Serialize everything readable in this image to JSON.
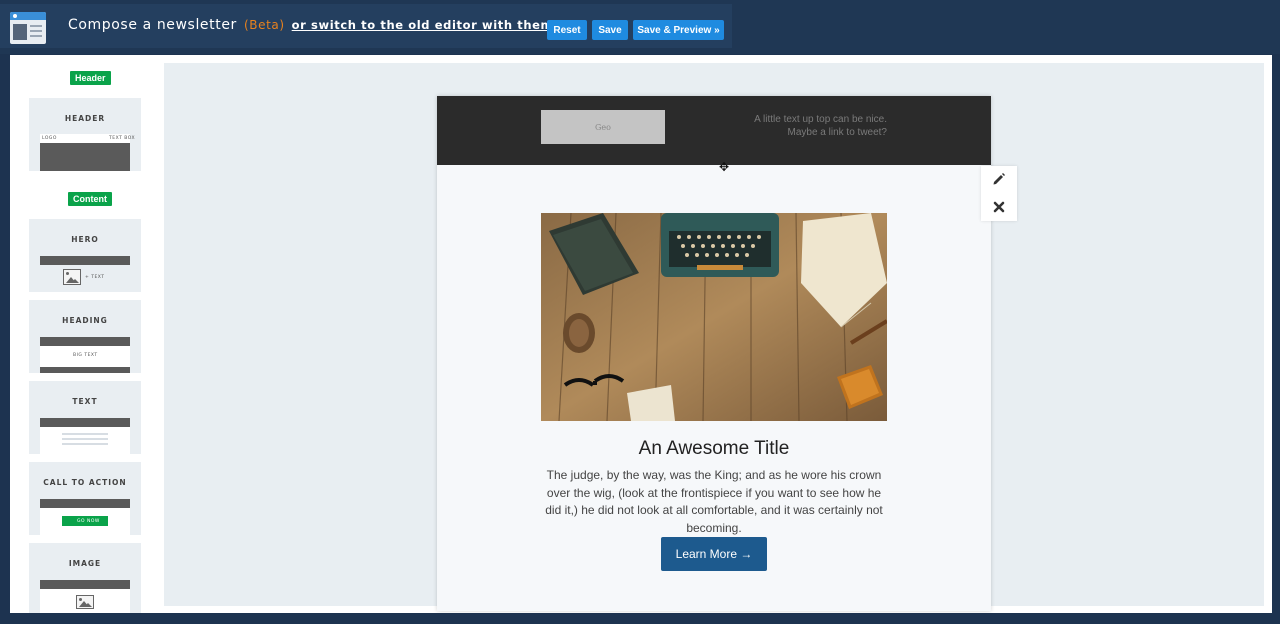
{
  "topbar": {
    "title": "Compose a newsletter",
    "beta": "(Beta)",
    "switch_link": "or switch to the old editor with themes.",
    "buttons": {
      "reset": "Reset",
      "save": "Save",
      "save_preview": "Save & Preview »"
    },
    "accent": "#1f8be0"
  },
  "sidebar": {
    "header_label": "Header",
    "content_label": "Content",
    "header_block": {
      "title": "HEADER",
      "mini_logo": "LOGO",
      "mini_text": "TEXT BOX"
    },
    "blocks": [
      {
        "title": "HERO",
        "thumb_text": "+ TEXT"
      },
      {
        "title": "HEADING",
        "thumb_text": "BIG TEXT"
      },
      {
        "title": "TEXT"
      },
      {
        "title": "CALL TO ACTION",
        "thumb_text": "GO NOW"
      },
      {
        "title": "IMAGE"
      }
    ],
    "label_color": "#0aa34a"
  },
  "email": {
    "logo_text": "Geo",
    "header_text_line1": "A little text up top can be nice.",
    "header_text_line2": "Maybe a link to tweet?",
    "hero_title": "An Awesome Title",
    "hero_body": "The judge, by the way, was the King; and as he wore his crown over the wig, (look at the frontispiece if you want to see how he did it,) he did not look at all comfortable, and it was certainly not becoming.",
    "cta_label": "Learn More →",
    "cta_color": "#1d5a8e"
  },
  "tools": {
    "edit_icon": "pencil-icon",
    "delete_icon": "close-icon",
    "move_icon": "move-icon"
  }
}
